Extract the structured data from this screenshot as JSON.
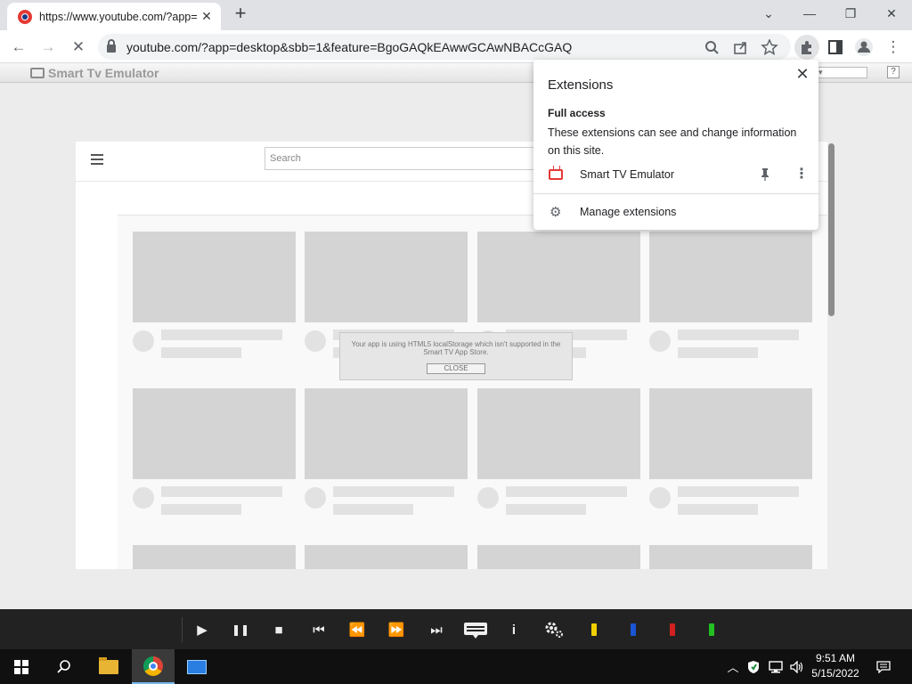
{
  "browser": {
    "tab_title": "https://www.youtube.com/?app=",
    "tab_close": "✕",
    "new_tab": "+",
    "window_controls": {
      "minimize": "—",
      "restore": "❐",
      "close": "✕",
      "tab_search": "⌄"
    },
    "url": "youtube.com/?app=desktop&sbb=1&feature=BgoGAQkEAwwGCAwNBACcGAQ",
    "back": "←",
    "forward": "→",
    "reload": "✕",
    "menu": "⋮"
  },
  "emulator": {
    "name": "Smart Tv Emulator",
    "help": "?"
  },
  "youtube": {
    "search_placeholder": "Search"
  },
  "toast": {
    "message": "Your app is using HTML5 localStorage which isn't supported in the Smart TV App Store.",
    "close_label": "CLOSE"
  },
  "extensions_popup": {
    "title": "Extensions",
    "close": "✕",
    "section_title": "Full access",
    "section_desc": "These extensions can see and change information on this site.",
    "extension_name": "Smart TV Emulator",
    "manage_label": "Manage extensions"
  },
  "remote": {
    "play": "▶",
    "pause": "❚❚",
    "stop": "■",
    "prev": "⏮",
    "rewind": "⏪",
    "fast_forward": "⏩",
    "next": "⏭",
    "info": "i",
    "color_keys": [
      "#f0d000",
      "#1a55d6",
      "#d22020",
      "#22c022"
    ]
  },
  "taskbar": {
    "time": "9:51 AM",
    "date": "5/15/2022"
  }
}
